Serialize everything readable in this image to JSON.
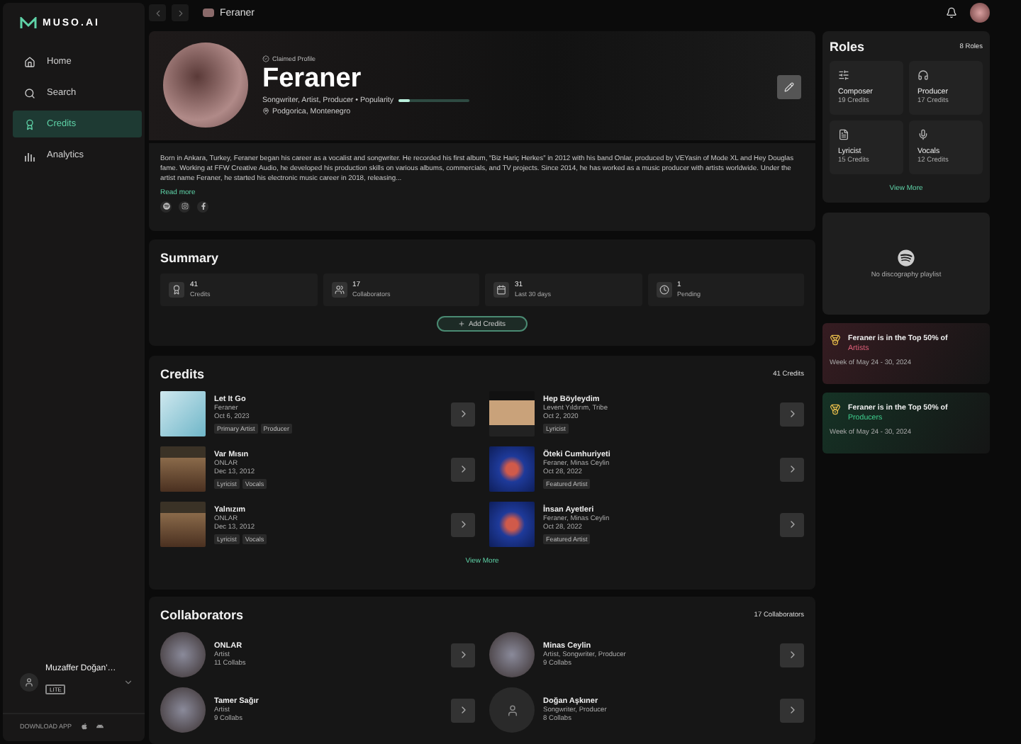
{
  "sidebar": {
    "logo": "MUSO.AI",
    "nav": [
      {
        "label": "Home",
        "selected": false
      },
      {
        "label": "Search",
        "selected": false
      },
      {
        "label": "Credits",
        "selected": true
      },
      {
        "label": "Analytics",
        "selected": false
      }
    ],
    "user": {
      "name": "Muzaffer Doğan'…",
      "plan": "LITE"
    },
    "download": "DOWNLOAD APP"
  },
  "topbar": {
    "breadcrumb": "Feraner"
  },
  "profile": {
    "badge": "Claimed Profile",
    "name": "Feraner",
    "roles": "Songwriter, Artist, Producer • Popularity",
    "popularity": {
      "level": 0.16
    },
    "location": "Podgorica, Montenegro",
    "bio": "Born in Ankara, Turkey, Feraner began his career as a vocalist and songwriter. He recorded his first album, “Biz Hariç Herkes” in 2012 with his band Onlar, produced by VEYasin of Mode XL and Hey Douglas fame. Working at FFW Creative Audio, he developed his production skills on various albums, commercials, and TV projects. Since 2014, he has worked as a music producer with artists worldwide. Under the artist name Feraner, he started his electronic music career in 2018, releasing...",
    "read_more": "Read more"
  },
  "summary": {
    "title": "Summary",
    "stats": [
      {
        "value": "41",
        "label": "Credits"
      },
      {
        "value": "17",
        "label": "Collaborators"
      },
      {
        "value": "31",
        "label": "Last 30 days"
      },
      {
        "value": "1",
        "label": "Pending"
      }
    ],
    "action": "Add Credits"
  },
  "credits": {
    "title": "Credits",
    "count": "41 Credits",
    "items": [
      {
        "title": "Let It Go",
        "artist": "Feraner",
        "date": "Oct 6, 2023",
        "tags": [
          "Primary Artist",
          "Producer"
        ]
      },
      {
        "title": "Hep Böyleydim",
        "artist": "Levent Yıldırım, Tribe",
        "date": "Oct 2, 2020",
        "tags": [
          "Lyricist"
        ]
      },
      {
        "title": "Var Mısın",
        "artist": "ONLAR",
        "date": "Dec 13, 2012",
        "tags": [
          "Lyricist",
          "Vocals"
        ]
      },
      {
        "title": "Öteki Cumhuriyeti",
        "artist": "Feraner, Minas Ceylin",
        "date": "Oct 28, 2022",
        "tags": [
          "Featured Artist"
        ]
      },
      {
        "title": "Yalnızım",
        "artist": "ONLAR",
        "date": "Dec 13, 2012",
        "tags": [
          "Lyricist",
          "Vocals"
        ]
      },
      {
        "title": "İnsan Ayetleri",
        "artist": "Feraner, Minas Ceylin",
        "date": "Oct 28, 2022",
        "tags": [
          "Featured Artist"
        ]
      }
    ],
    "view_more": "View More"
  },
  "collaborators": {
    "title": "Collaborators",
    "count": "17 Collaborators",
    "items": [
      {
        "name": "ONLAR",
        "roles": "Artist",
        "collabs": "11 Collabs",
        "kind": "photo"
      },
      {
        "name": "Minas Ceylin",
        "roles": "Artist, Songwriter, Producer",
        "collabs": "9 Collabs",
        "kind": "photo"
      },
      {
        "name": "Tamer Sağır",
        "roles": "Artist",
        "collabs": "9 Collabs",
        "kind": "photo"
      },
      {
        "name": "Doğan Aşkıner",
        "roles": "Songwriter, Producer",
        "collabs": "8 Collabs",
        "kind": "generic"
      }
    ]
  },
  "roles": {
    "title": "Roles",
    "count": "8 Roles",
    "items": [
      {
        "name": "Composer",
        "credits": "19 Credits"
      },
      {
        "name": "Producer",
        "credits": "17 Credits"
      },
      {
        "name": "Lyricist",
        "credits": "15 Credits"
      },
      {
        "name": "Vocals",
        "credits": "12 Credits"
      }
    ],
    "view_more": "View More"
  },
  "playlist": {
    "message": "No discography playlist"
  },
  "rankings": [
    {
      "headline": "Feraner is in the Top 50% of",
      "category": "Artists",
      "week": "Week of May 24 - 30, 2024",
      "color": "#e0607a"
    },
    {
      "headline": "Feraner is in the Top 50% of",
      "category": "Producers",
      "week": "Week of May 24 - 30, 2024",
      "color": "#3fcf8e"
    }
  ]
}
